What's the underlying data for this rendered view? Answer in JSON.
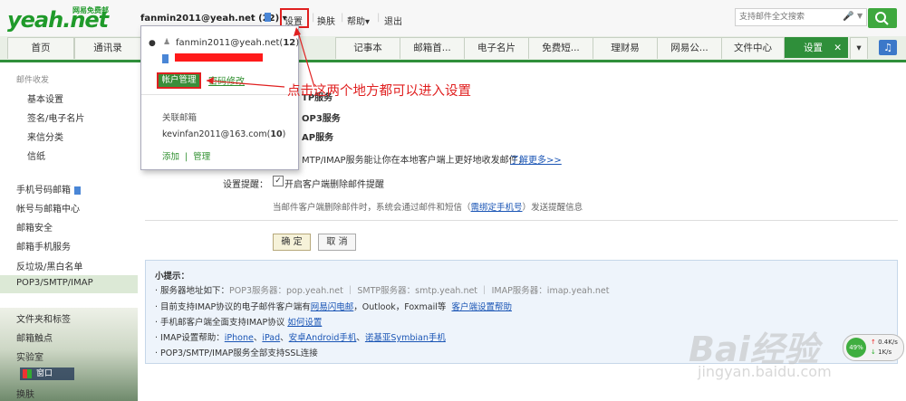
{
  "header": {
    "logo_text": "yeah.net",
    "logo_sub": "网易免费邮",
    "account": "fanmin2011@yeah.net (22) ▾",
    "nav": [
      "设置",
      "换肤",
      "帮助▾",
      "退出"
    ],
    "search_placeholder": "支持邮件全文搜索"
  },
  "tabs": [
    "首页",
    "通讯录",
    "记事本",
    "邮箱首...",
    "电子名片",
    "免费短...",
    "理财易",
    "网易公...",
    "文件中心",
    "设置"
  ],
  "sidebar": {
    "group_title": "邮件收发",
    "items_top": [
      "基本设置",
      "签名/电子名片",
      "来信分类",
      "信纸"
    ],
    "items_mid": [
      "手机号码邮箱",
      "帐号与邮箱中心",
      "邮箱安全",
      "邮箱手机服务",
      "反垃圾/黑白名单",
      "POP3/SMTP/IMAP"
    ],
    "items_bottom": [
      "文件夹和标签",
      "邮箱触点",
      "实验室",
      "换肤"
    ]
  },
  "popup": {
    "account": "fanmin2011@yeah.net",
    "count": "12",
    "account_mgmt": "帐户管理",
    "pwd_change": "密码修改",
    "linked_title": "关联邮箱",
    "linked_email": "kevinfan2011@163.com",
    "linked_count": "10",
    "add": "添加",
    "manage": "管理"
  },
  "annotation": "点击这两个地方都可以进入设置",
  "main": {
    "fragments": [
      "TP服务",
      "OP3服务",
      "AP服务",
      "MTP/IMAP服务能让你在本地客户端上更好地收发邮件，"
    ],
    "learn_more": "了解更多>>",
    "reminder_label": "设置提醒：",
    "reminder_checkbox": "开启客户端删除邮件提醒",
    "reminder_desc": "当邮件客户端删除邮件时，系统会通过邮件和短信",
    "reminder_link": "需绑定手机号",
    "reminder_tail": "发送提醒信息",
    "ok": "确 定",
    "cancel": "取 消"
  },
  "tips": {
    "title": "小提示：",
    "line1_a": "· 服务器地址如下：",
    "line1_b": "POP3服务器：pop.yeah.net ｜ SMTP服务器：smtp.yeah.net ｜ IMAP服务器：imap.yeah.net",
    "line2_a": "· 目前支持IMAP协议的电子邮件客户端有",
    "line2_link1": "网易闪电邮",
    "line2_b": "，Outlook，Foxmail等",
    "line2_link2": "客户端设置帮助",
    "line3_a": "· 手机邮客户端全面支持IMAP协议",
    "line3_link": "如何设置",
    "line4_a": "· IMAP设置帮助：",
    "line4_links": [
      "iPhone",
      "iPad",
      "安卓Android手机",
      "诺基亚Symbian手机"
    ],
    "line5": "· POP3/SMTP/IMAP服务全部支持SSL连接"
  },
  "speed": {
    "percent": "49%",
    "up": "0.4K/s",
    "down": "1K/s"
  },
  "watermark": "Bai经验",
  "watermark2": "jingyan.baidu.com",
  "taskbar_label": "窗口"
}
